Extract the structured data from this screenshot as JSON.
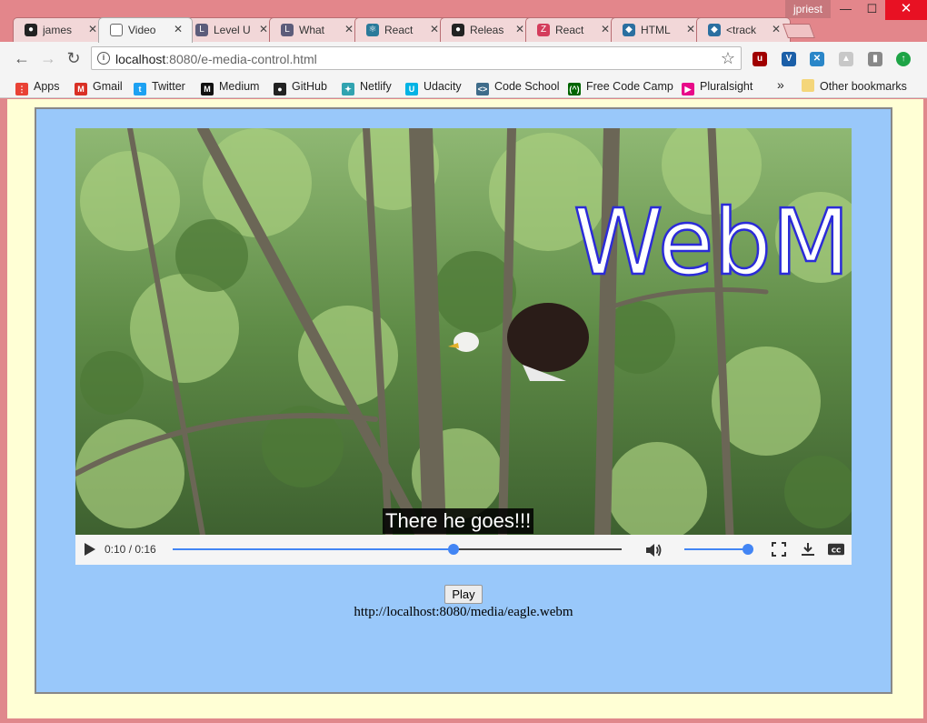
{
  "window": {
    "user": "jpriest",
    "minimize": "—",
    "maximize": "☐",
    "close": "✕"
  },
  "tabs": [
    {
      "label": "james",
      "icon": "github-icon",
      "icon_color": "#222222",
      "icon_glyph": "●"
    },
    {
      "label": "Video",
      "icon": "page-icon",
      "icon_color": "#ffffff",
      "icon_glyph": "",
      "active": true
    },
    {
      "label": "Level U",
      "icon": "level-icon",
      "icon_color": "#5c5c7a",
      "icon_glyph": "L"
    },
    {
      "label": "What",
      "icon": "level-icon",
      "icon_color": "#5c5c7a",
      "icon_glyph": "L"
    },
    {
      "label": "React",
      "icon": "react-icon",
      "icon_color": "#2a7a9a",
      "icon_glyph": "⚛"
    },
    {
      "label": "Releas",
      "icon": "github-icon",
      "icon_color": "#222222",
      "icon_glyph": "●"
    },
    {
      "label": "React",
      "icon": "zero-icon",
      "icon_color": "#d43d5c",
      "icon_glyph": "Z"
    },
    {
      "label": "HTML",
      "icon": "mdn-icon",
      "icon_color": "#2b6fa0",
      "icon_glyph": "◆"
    },
    {
      "label": "<track",
      "icon": "mdn-icon",
      "icon_color": "#2b6fa0",
      "icon_glyph": "◆"
    }
  ],
  "tab_close": "✕",
  "toolbar": {
    "back": "←",
    "forward": "→",
    "reload": "↻",
    "url_host": "localhost",
    "url_path": ":8080/e-media-control.html",
    "star": "☆"
  },
  "bookmarks": [
    {
      "label": "Apps",
      "icon": "apps-icon",
      "color": "#e94235",
      "glyph": "⋮"
    },
    {
      "label": "Gmail",
      "icon": "gmail-icon",
      "color": "#d93025",
      "glyph": "M"
    },
    {
      "label": "Twitter",
      "icon": "twitter-icon",
      "color": "#1da1f2",
      "glyph": "t"
    },
    {
      "label": "Medium",
      "icon": "medium-icon",
      "color": "#111111",
      "glyph": "M"
    },
    {
      "label": "GitHub",
      "icon": "github-icon",
      "color": "#222222",
      "glyph": "●"
    },
    {
      "label": "Netlify",
      "icon": "netlify-icon",
      "color": "#31a3b0",
      "glyph": "✦"
    },
    {
      "label": "Udacity",
      "icon": "udacity-icon",
      "color": "#02b3e4",
      "glyph": "U"
    },
    {
      "label": "Code School",
      "icon": "codeschool-icon",
      "color": "#3f6c8a",
      "glyph": "<>"
    },
    {
      "label": "Free Code Camp",
      "icon": "freecodecamp-icon",
      "color": "#006400",
      "glyph": "(^)"
    },
    {
      "label": "Pluralsight",
      "icon": "pluralsight-icon",
      "color": "#e80a89",
      "glyph": "▶"
    }
  ],
  "bookmarks_more": "»",
  "other_bookmarks": "Other bookmarks",
  "video": {
    "overlay_text": "WebM",
    "caption": "There he goes!!!",
    "time": "0:10 / 0:16",
    "progress": 0.625,
    "volume": 1.0
  },
  "play_button": "Play",
  "source_url": "http://localhost:8080/media/eagle.webm"
}
